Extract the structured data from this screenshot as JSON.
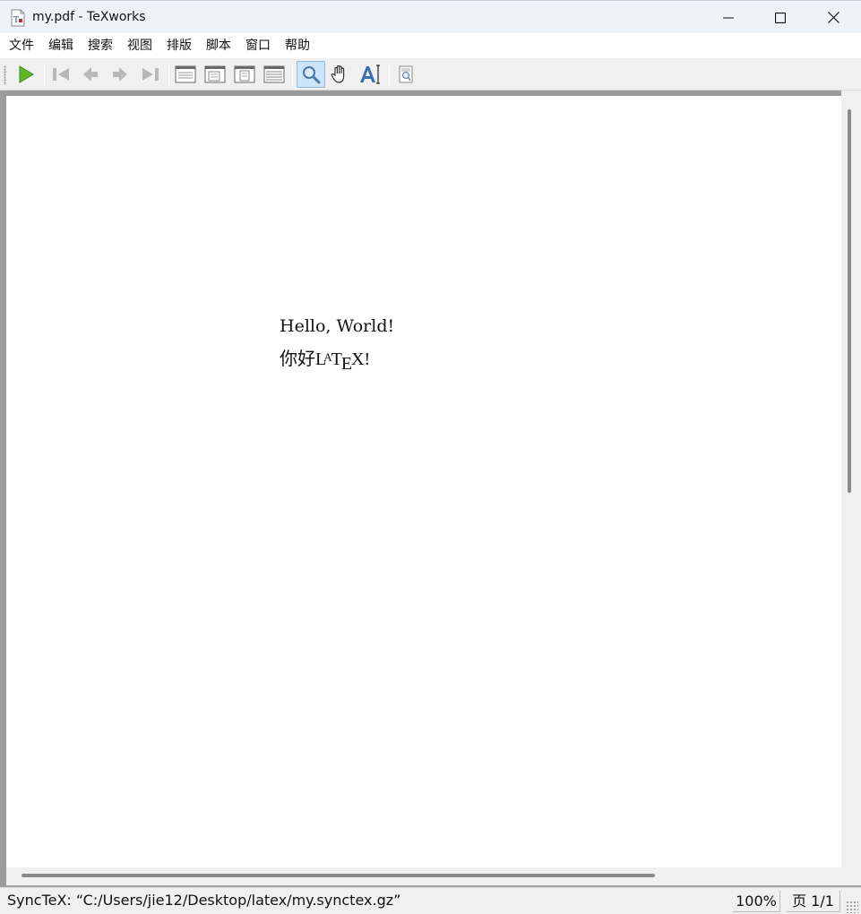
{
  "window": {
    "title": "my.pdf - TeXworks",
    "icon": "pdf-document-icon",
    "controls": [
      "minimize-icon",
      "maximize-icon",
      "close-icon"
    ]
  },
  "menu": {
    "items": [
      {
        "label": "文件"
      },
      {
        "label": "编辑"
      },
      {
        "label": "搜索"
      },
      {
        "label": "视图"
      },
      {
        "label": "排版"
      },
      {
        "label": "脚本"
      },
      {
        "label": "窗口"
      },
      {
        "label": "帮助"
      }
    ]
  },
  "toolbar": {
    "buttons": [
      {
        "icon": "typeset-play-icon"
      },
      {
        "icon": "first-page-icon"
      },
      {
        "icon": "previous-page-icon"
      },
      {
        "icon": "next-page-icon"
      },
      {
        "icon": "last-page-icon"
      },
      {
        "icon": "actual-size-icon"
      },
      {
        "icon": "fit-width-icon"
      },
      {
        "icon": "fit-window-icon"
      },
      {
        "icon": "fit-content-icon"
      },
      {
        "icon": "magnify-tool-icon",
        "active": true
      },
      {
        "icon": "hand-scroll-icon"
      },
      {
        "icon": "select-text-icon"
      },
      {
        "icon": "goto-source-icon"
      }
    ]
  },
  "document": {
    "line1": "Hello, World!",
    "line2_prefix": "你好",
    "line2_logo": "LaTeX",
    "line2_suffix": "X!",
    "logo_L": "L",
    "logo_A": "A",
    "logo_T": "T",
    "logo_E": "E"
  },
  "status": {
    "synctex": "SyncTeX: “C:/Users/jie12/Desktop/latex/my.synctex.gz”",
    "zoom": "100%",
    "page": "页 1/1"
  },
  "colors": {
    "titlebar": "#eef3f9",
    "chrome": "#f0f0f0",
    "active_tool": "#cce4f7",
    "play_green": "#5cb82a"
  }
}
